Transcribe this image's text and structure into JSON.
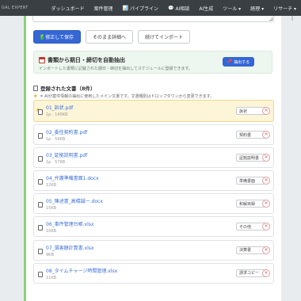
{
  "brand": "GAL EXPERT",
  "nav": [
    {
      "label": "ダッシュボード",
      "icon": ""
    },
    {
      "label": "案件管理",
      "icon": ""
    },
    {
      "label": "パイプライン",
      "icon": "chart-icon"
    },
    {
      "label": "AI相談",
      "icon": "chat-icon"
    },
    {
      "label": "AI生成",
      "icon": ""
    },
    {
      "label": "ツール ▾",
      "icon": ""
    },
    {
      "label": "経理 ▾",
      "icon": ""
    },
    {
      "label": "リサーチ ▾",
      "icon": ""
    }
  ],
  "actions": {
    "save": "修正して保存",
    "keep": "そのまま詳細へ",
    "continue_import": "続けてインポート"
  },
  "extract": {
    "title": "書類から期日・締切を自動抽出",
    "description": "インポートした書類に記載された期日・締切を抽出してスケジュールに登録できます。",
    "button": "抽出する"
  },
  "documents": {
    "title": "登録された文書（8件）",
    "note": "= AIが案件情報の抽出に使用したメイン文書です。文書種別はドロップダウンから変更できます。",
    "items": [
      {
        "name": "01_訴状.pdf",
        "meta": "1p · 145KB",
        "type": "訴状",
        "main": true
      },
      {
        "name": "02_委任契約書.pdf",
        "meta": "1p · 59KB",
        "type": "契約書",
        "main": false
      },
      {
        "name": "03_証拠説明書.pdf",
        "meta": "1p · 57KB",
        "type": "証拠説明書",
        "main": false
      },
      {
        "name": "04_弁護準備書面1.docx",
        "meta": "12KB",
        "type": "準備書面",
        "main": false
      },
      {
        "name": "05_陳述書_高橋誠一.docx",
        "meta": "15KB",
        "type": "和解目録",
        "main": false
      },
      {
        "name": "06_事件管理台帳.xlsx",
        "meta": "10KB",
        "type": "その他",
        "main": false
      },
      {
        "name": "07_損害額計算書.xlsx",
        "meta": "9KB",
        "type": "決算書",
        "main": false
      },
      {
        "name": "08_タイムチャージ時間管理.xlsx",
        "meta": "11KB",
        "type": "請求コピー",
        "main": false
      }
    ]
  }
}
